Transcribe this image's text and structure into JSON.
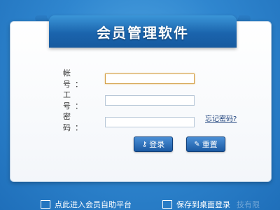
{
  "banner": {
    "title": "会员管理软件"
  },
  "form": {
    "account_label": "帐 号：",
    "account_value": "",
    "employee_label": "工 号：",
    "employee_value": "",
    "password_label": "密 码：",
    "password_value": "",
    "forgot_link": "忘记密码?"
  },
  "buttons": {
    "login_label": "登录",
    "reset_label": "重置"
  },
  "footer": {
    "self_service": "点此进入会员自助平台",
    "save_desktop": "保存到桌面登录",
    "watermark": "技有限"
  },
  "icons": {
    "login": "key-icon",
    "reset": "pencil-icon",
    "self_service": "monitor-icon",
    "save_desktop": "desktop-icon"
  },
  "colors": {
    "background": "#2f86cf",
    "banner": "#1b64ad",
    "button": "#1b5aa3",
    "focus_border": "#d4a24a"
  }
}
